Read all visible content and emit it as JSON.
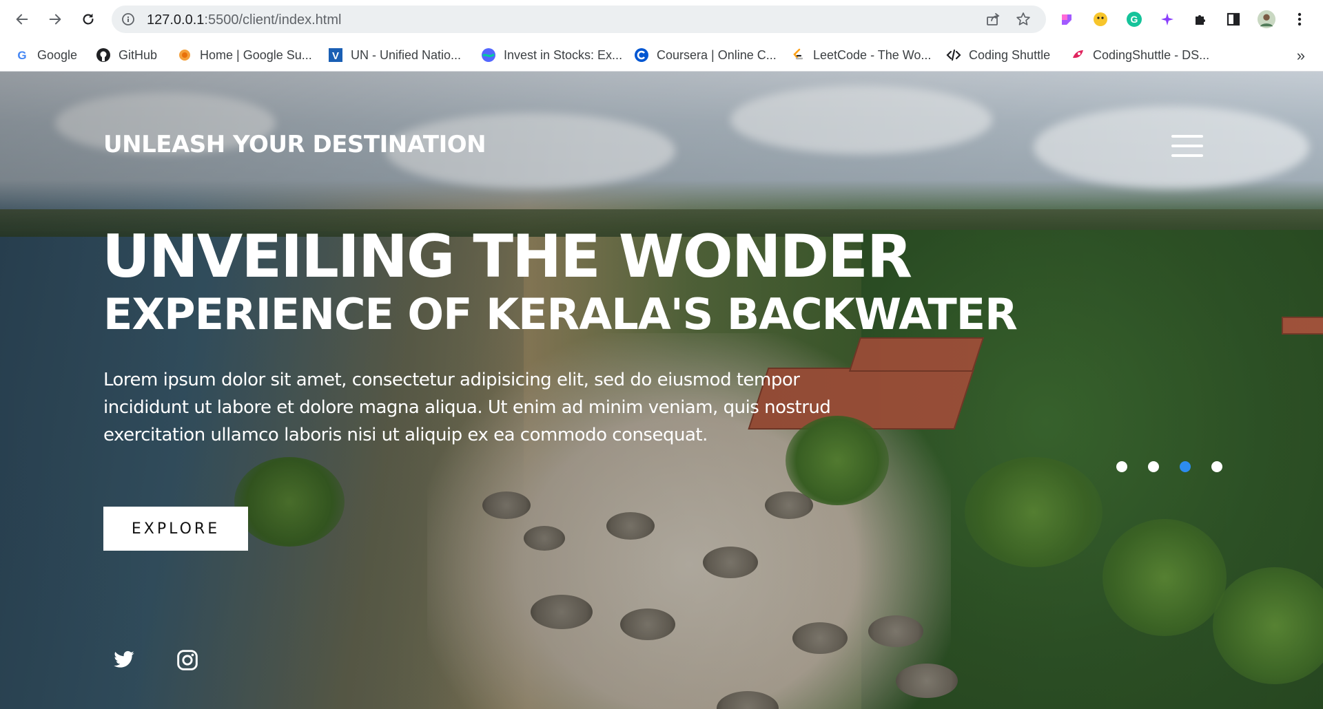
{
  "browser": {
    "url_host": "127.0.0.1",
    "url_path": ":5500/client/index.html",
    "bookmarks": [
      {
        "label": "Google",
        "icon": "google-icon"
      },
      {
        "label": "GitHub",
        "icon": "github-icon"
      },
      {
        "label": "Home | Google Su...",
        "icon": "google-summer-icon"
      },
      {
        "label": "UN - Unified Natio...",
        "icon": "v-icon"
      },
      {
        "label": "Invest in Stocks: Ex...",
        "icon": "invest-icon"
      },
      {
        "label": "Coursera | Online C...",
        "icon": "coursera-icon"
      },
      {
        "label": "LeetCode - The Wo...",
        "icon": "leetcode-icon"
      },
      {
        "label": "Coding Shuttle",
        "icon": "code-icon"
      },
      {
        "label": "CodingShuttle - DS...",
        "icon": "codingshuttle-icon"
      }
    ],
    "bookmarks_more": "»"
  },
  "hero": {
    "brand": "UNLEASH YOUR DESTINATION",
    "title_line1": "UNVEILING THE WONDER",
    "title_line2": "EXPERIENCE OF KERALA'S BACKWATER",
    "paragraph": "Lorem ipsum dolor sit amet, consectetur adipisicing elit, sed do eiusmod tempor incididunt ut labore et dolore magna aliqua. Ut enim ad minim veniam, quis nostrud exercitation ullamco laboris nisi ut aliquip ex ea commodo consequat.",
    "cta_label": "EXPLORE",
    "slider": {
      "count": 4,
      "active_index": 2,
      "active_color": "#2d8cf0"
    },
    "social": [
      "twitter-icon",
      "instagram-icon"
    ]
  }
}
